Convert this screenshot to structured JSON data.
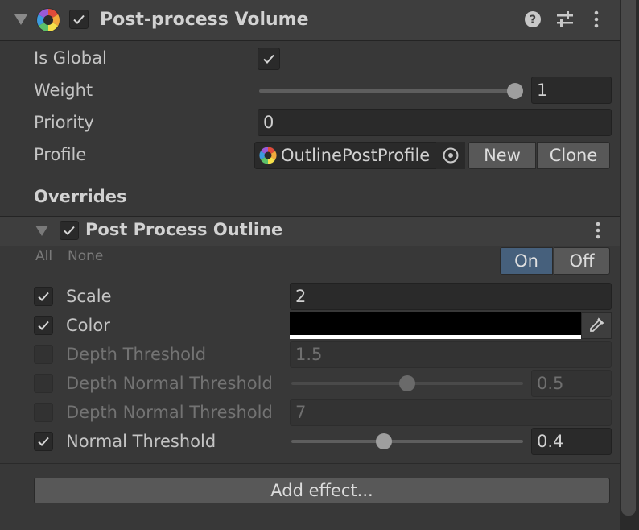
{
  "header": {
    "title": "Post-process Volume",
    "enabled": true,
    "icons": [
      "help-icon",
      "presets-icon",
      "more-menu-icon"
    ]
  },
  "fields": {
    "is_global_label": "Is Global",
    "is_global": true,
    "weight_label": "Weight",
    "weight_value": "1",
    "weight_fraction": 1.0,
    "priority_label": "Priority",
    "priority_value": "0",
    "profile_label": "Profile",
    "profile_value": "OutlinePostProfile",
    "new_label": "New",
    "clone_label": "Clone"
  },
  "overrides_label": "Overrides",
  "effect": {
    "title": "Post Process Outline",
    "enabled": true,
    "all_label": "All",
    "none_label": "None",
    "on_label": "On",
    "off_label": "Off",
    "active_toggle": "On",
    "properties": [
      {
        "label": "Scale",
        "override": true,
        "value": "2"
      },
      {
        "label": "Color",
        "override": true,
        "color": "#000000"
      },
      {
        "label": "Depth Threshold",
        "override": false,
        "value": "1.5"
      },
      {
        "label": "Depth Normal Threshold",
        "override": false,
        "value": "0.5",
        "slider_fraction": 0.5
      },
      {
        "label": "Depth Normal Threshold",
        "override": false,
        "value": "7"
      },
      {
        "label": "Normal Threshold",
        "override": true,
        "value": "0.4",
        "slider_fraction": 0.4
      }
    ]
  },
  "add_effect_label": "Add effect..."
}
